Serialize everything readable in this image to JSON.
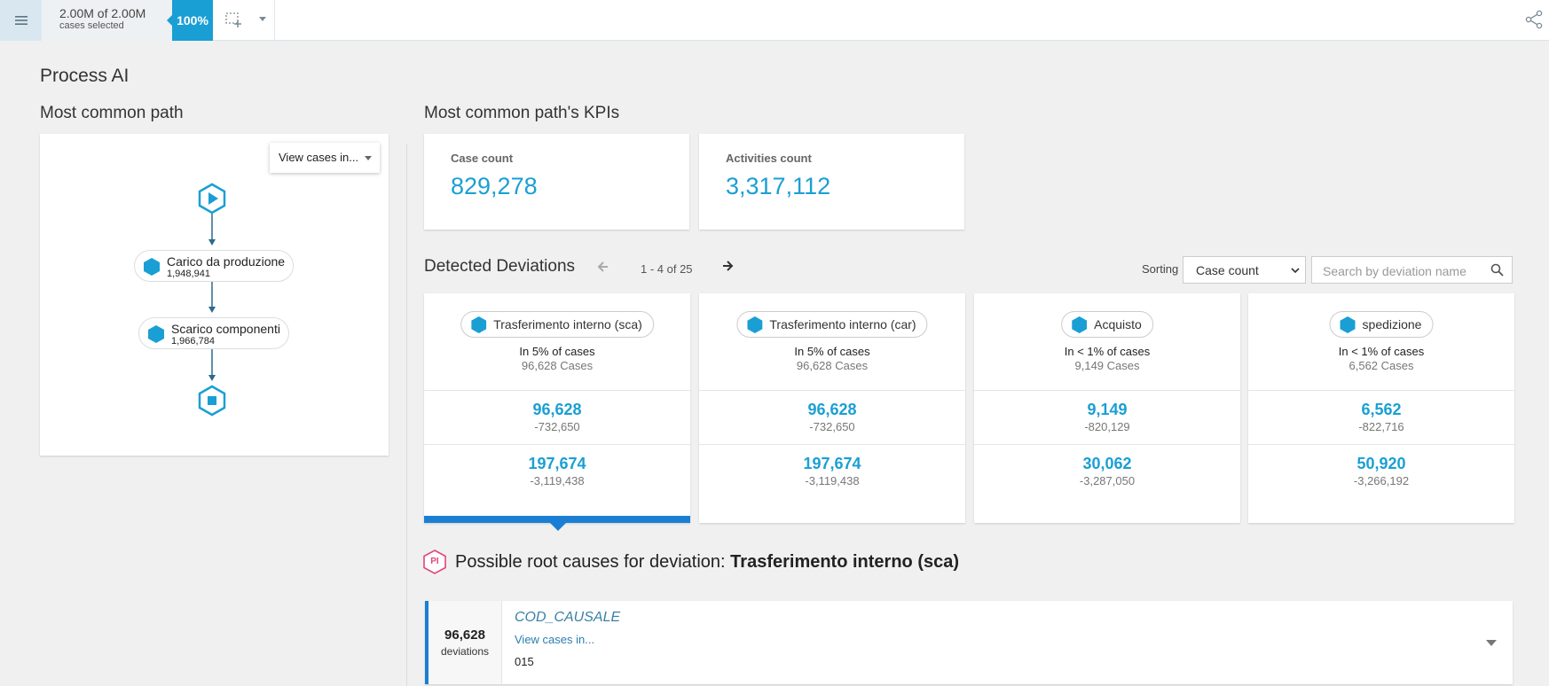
{
  "topbar": {
    "menu_icon": "hamburger-icon",
    "selection_main": "2.00M of 2.00M",
    "selection_sub": "cases selected",
    "percent": "100%",
    "accent": "#1a9fd4"
  },
  "page_title": "Process AI",
  "path_section": {
    "title": "Most common path",
    "view_button": "View cases in...",
    "nodes": [
      {
        "name": "Carico da produzione",
        "count": "1,948,941"
      },
      {
        "name": "Scarico componenti",
        "count": "1,966,784"
      }
    ]
  },
  "kpi_section": {
    "title": "Most common path's KPIs",
    "cards": [
      {
        "label": "Case count",
        "value": "829,278"
      },
      {
        "label": "Activities count",
        "value": "3,317,112"
      }
    ]
  },
  "deviations": {
    "title": "Detected Deviations",
    "pager": "1 - 4 of 25",
    "sorting_label": "Sorting",
    "sorting_value": "Case count",
    "search_placeholder": "Search by deviation name",
    "cards": [
      {
        "name": "Trasferimento interno (sca)",
        "pct": "In 5% of cases",
        "cases": "96,628 Cases",
        "v1": "96,628",
        "d1": "-732,650",
        "v2": "197,674",
        "d2": "-3,119,438"
      },
      {
        "name": "Trasferimento interno (car)",
        "pct": "In 5% of cases",
        "cases": "96,628 Cases",
        "v1": "96,628",
        "d1": "-732,650",
        "v2": "197,674",
        "d2": "-3,119,438"
      },
      {
        "name": "Acquisto",
        "pct": "In < 1% of cases",
        "cases": "9,149 Cases",
        "v1": "9,149",
        "d1": "-820,129",
        "v2": "30,062",
        "d2": "-3,287,050"
      },
      {
        "name": "spedizione",
        "pct": "In < 1% of cases",
        "cases": "6,562 Cases",
        "v1": "6,562",
        "d1": "-822,716",
        "v2": "50,920",
        "d2": "-3,266,192"
      }
    ]
  },
  "root_causes": {
    "badge": "PI",
    "title_prefix": "Possible root causes for deviation:",
    "title_deviation": "Trasferimento interno (sca)",
    "item": {
      "count": "96,628",
      "count_label": "deviations",
      "attribute": "COD_CAUSALE",
      "link": "View cases in...",
      "value": "015"
    }
  }
}
